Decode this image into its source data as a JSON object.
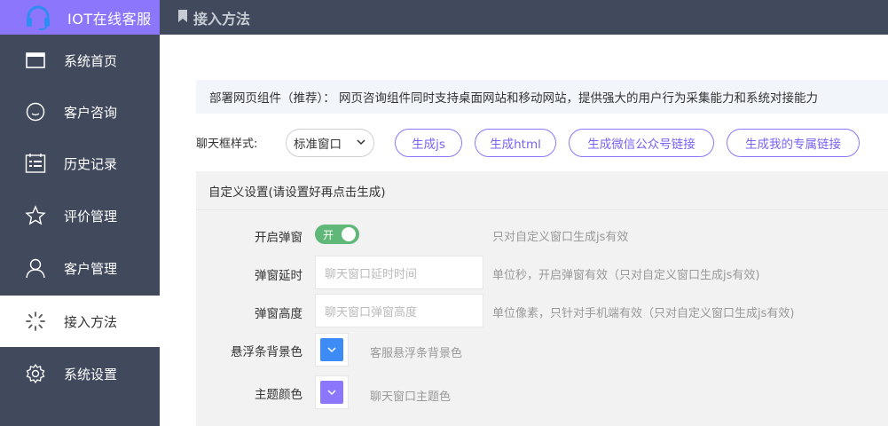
{
  "brand": {
    "name": "IOT在线客服",
    "color": "#8c76fb"
  },
  "sidebar": {
    "items": [
      {
        "label": "系统首页",
        "icon": "window-icon"
      },
      {
        "label": "客户咨询",
        "icon": "smile-icon"
      },
      {
        "label": "历史记录",
        "icon": "calendar-icon"
      },
      {
        "label": "评价管理",
        "icon": "star-icon"
      },
      {
        "label": "客户管理",
        "icon": "user-icon"
      },
      {
        "label": "接入方法",
        "icon": "loading-icon",
        "active": true
      },
      {
        "label": "系统设置",
        "icon": "gear-icon"
      }
    ]
  },
  "header": {
    "title": "接入方法",
    "icon": "bookmark-icon"
  },
  "notice": {
    "text": "部署网页组件（推荐）：  网页咨询组件同时支持桌面网站和移动网站，提供强大的用户行为采集能力和系统对接能力"
  },
  "style_row": {
    "label": "聊天框样式:",
    "select_value": "标准窗口",
    "buttons": [
      "生成js",
      "生成html",
      "生成微信公众号链接",
      "生成我的专属链接"
    ]
  },
  "custom": {
    "title": "自定义设置(请设置好再点击生成)",
    "popup": {
      "label": "开启弹窗",
      "toggle_text": "开",
      "toggle_on": true,
      "hint": "只对自定义窗口生成js有效"
    },
    "delay": {
      "label": "弹窗延时",
      "placeholder": "聊天窗口延时时间",
      "hint": "单位秒，开启弹窗有效（只对自定义窗口生成js有效)"
    },
    "height": {
      "label": "弹窗高度",
      "placeholder": "聊天窗口弹窗高度",
      "hint": "单位像素，只针对手机端有效（只对自定义窗口生成js有效)"
    },
    "float_bg": {
      "label": "悬浮条背景色",
      "color": "#3d8bf5",
      "hint": "客服悬浮条背景色"
    },
    "theme": {
      "label": "主题颜色",
      "color": "#8c76fb",
      "hint": "聊天窗口主题色"
    }
  }
}
